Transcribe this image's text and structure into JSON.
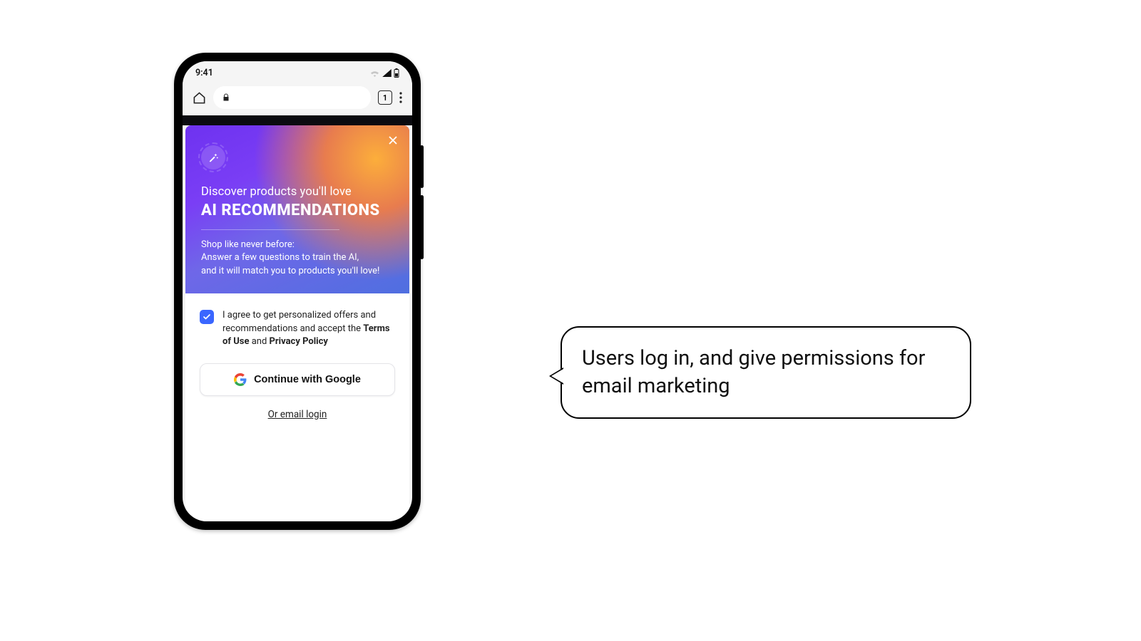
{
  "statusbar": {
    "time": "9:41"
  },
  "browser": {
    "tab_count": "1"
  },
  "modal": {
    "subtitle": "Discover products you'll love",
    "title": "AI RECOMMENDATIONS",
    "body_line1": "Shop like never before:",
    "body_line2": "Answer a few questions to train the AI,",
    "body_line3": "and it will match you to products you'll love!",
    "consent_pre": "I agree to get personalized offers and recommendations and accept the ",
    "terms_label": "Terms of Use",
    "consent_mid": " and ",
    "privacy_label": "Privacy Policy",
    "google_button": "Continue with Google",
    "email_link": "Or email login"
  },
  "annotation": {
    "text": "Users log in, and give permissions for email marketing"
  }
}
